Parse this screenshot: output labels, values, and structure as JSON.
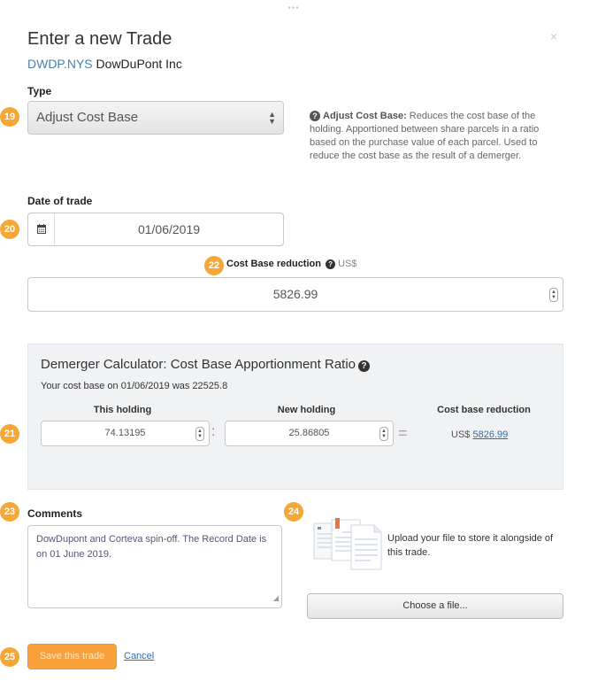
{
  "modal": {
    "grip": "•••",
    "close": "×",
    "title": "Enter a new Trade",
    "ticker": "DWDP.NYS",
    "company": "DowDuPont Inc"
  },
  "badges": {
    "type": "19",
    "date": "20",
    "calculator": "21",
    "cost_base": "22",
    "comments": "23",
    "upload": "24",
    "save": "25"
  },
  "type_field": {
    "label": "Type",
    "selected": "Adjust Cost Base",
    "help_title": "Adjust Cost Base:",
    "help_text": " Reduces the cost base of the holding. Apportioned between share parcels in a ratio based on the purchase value of each parcel. Used to reduce the cost base as the result of a demerger."
  },
  "date_field": {
    "label": "Date of trade",
    "value": "01/06/2019",
    "icon": "calendar-icon"
  },
  "cost_base": {
    "label": "Cost Base reduction",
    "currency": "US$",
    "value": "5826.99"
  },
  "calculator": {
    "title": "Demerger Calculator: Cost Base Apportionment Ratio",
    "subtitle": "Your cost base on 01/06/2019 was 22525.8",
    "this_holding_label": "This holding",
    "new_holding_label": "New holding",
    "result_label": "Cost base reduction",
    "this_holding_value": "74.13195",
    "new_holding_value": "25.86805",
    "colon": ":",
    "equals": "=",
    "result_currency": "US$",
    "result_value": "5826.99"
  },
  "comments": {
    "label": "Comments",
    "value": "DowDupont and Corteva spin-off. The Record Date is on 01 June 2019."
  },
  "upload": {
    "text": "Upload your file to store it alongside of this trade.",
    "button": "Choose a file..."
  },
  "actions": {
    "save": "Save this trade",
    "cancel": "Cancel"
  },
  "colors": {
    "accent": "#f7a735",
    "link": "#2a6fb0",
    "ticker": "#4a7fa8"
  }
}
